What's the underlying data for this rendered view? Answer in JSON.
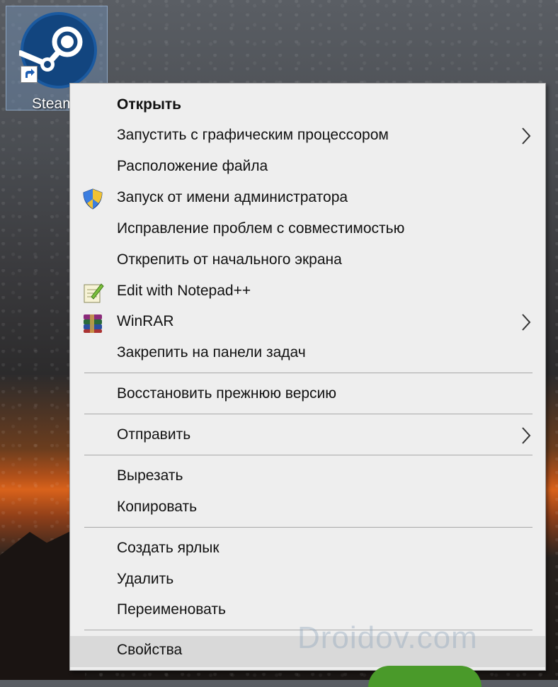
{
  "desktop": {
    "icon_label": "Steam"
  },
  "menu": {
    "items": [
      {
        "label": "Открыть"
      },
      {
        "label": "Запустить с графическим процессором"
      },
      {
        "label": "Расположение файла"
      },
      {
        "label": "Запуск от имени администратора",
        "icon": "uac-shield-icon"
      },
      {
        "label": "Исправление проблем с совместимостью"
      },
      {
        "label": "Открепить от начального экрана"
      },
      {
        "label": "Edit with Notepad++",
        "icon": "notepadpp-icon"
      },
      {
        "label": "WinRAR",
        "icon": "winrar-icon"
      },
      {
        "label": "Закрепить на панели задач"
      },
      {
        "label": "Восстановить прежнюю версию"
      },
      {
        "label": "Отправить"
      },
      {
        "label": "Вырезать"
      },
      {
        "label": "Копировать"
      },
      {
        "label": "Создать ярлык"
      },
      {
        "label": "Удалить"
      },
      {
        "label": "Переименовать"
      },
      {
        "label": "Свойства"
      }
    ]
  },
  "watermark": "Droidov.com",
  "colors": {
    "menu_bg": "#eeeeee",
    "hover_bg": "#d9d9d9",
    "separator": "#a8a8a8"
  }
}
